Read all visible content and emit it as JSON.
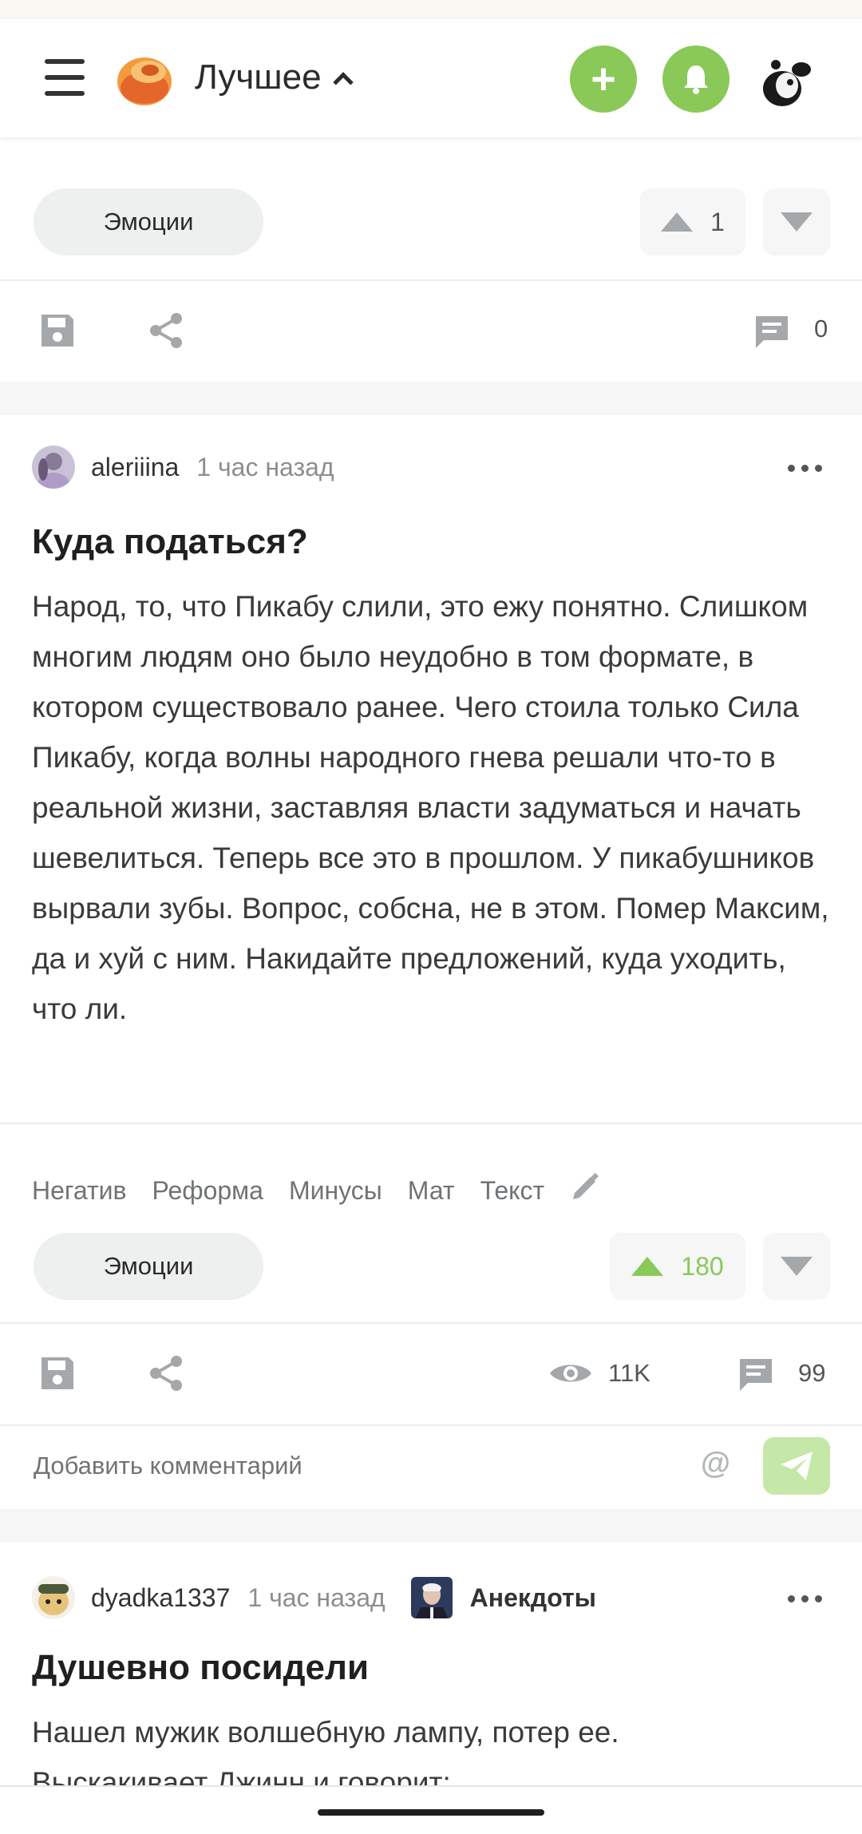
{
  "header": {
    "section_title": "Лучшее",
    "add_label": "+"
  },
  "post_prev": {
    "emotions_label": "Эмоции",
    "rating": "1",
    "comments_count": "0"
  },
  "post_main": {
    "username": "aleriiina",
    "time_ago": "1 час назад",
    "title": "Куда податься?",
    "body": "Народ, то, что Пикабу слили, это ежу понятно. Слишком многим людям оно было неудобно в том формате, в котором существовало ранее. Чего стоила только Сила Пикабу, когда волны народного гнева решали что-то в реальной жизни, заставляя власти задуматься и начать шевелиться. Теперь все это в прошлом. У пикабушников вырвали зубы. Вопрос, собсна, не в этом. Помер Максим, да и хуй с ним. Накидайте предложений, куда уходить, что ли.",
    "tags": [
      "Негатив",
      "Реформа",
      "Минусы",
      "Мат",
      "Текст"
    ],
    "emotions_label": "Эмоции",
    "rating": "180",
    "views": "11K",
    "comments_count": "99",
    "comment_placeholder": "Добавить комментарий",
    "at_symbol": "@"
  },
  "post_next": {
    "username": "dyadka1337",
    "time_ago": "1 час назад",
    "community": "Анекдоты",
    "title": "Душевно посидели",
    "body_line1": "Нашел мужик волшебную лампу, потер ее.",
    "body_line2": "Выскакивает Джинн и говорит:"
  },
  "colors": {
    "accent_green": "#8ac858",
    "send_disabled": "#c5e8a9",
    "icon_gray": "#a5a8ab"
  }
}
